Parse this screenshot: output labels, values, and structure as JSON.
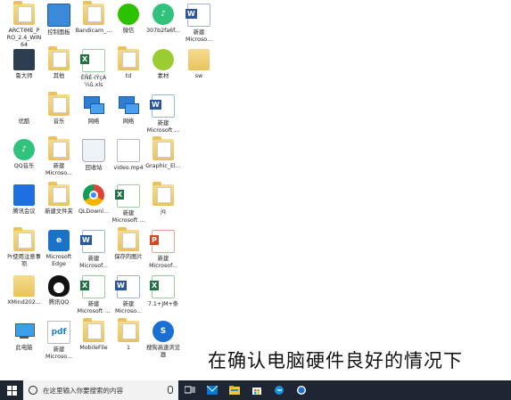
{
  "desktop": {
    "icons": [
      {
        "label": "ARCTIME_P\nRO_2.4_WIN\n64",
        "icon": "arctime-folder-icon",
        "glyph": "folder",
        "text": ""
      },
      {
        "label": "控制面板",
        "icon": "control-panel-icon",
        "glyph": "ctrl",
        "text": ""
      },
      {
        "label": "Bandicam_...",
        "icon": "bandicam-folder-icon",
        "glyph": "folder",
        "text": ""
      },
      {
        "label": "微信",
        "icon": "wechat-icon",
        "glyph": "wechat",
        "text": ""
      },
      {
        "label": "307b2fa6f...",
        "icon": "qq-music-file-icon",
        "glyph": "qqmusic",
        "text": "♪"
      },
      {
        "label": "新建\nMicroso...",
        "icon": "word-doc-icon",
        "glyph": "word",
        "text": "W"
      },
      {
        "label": "鲁大师",
        "icon": "ludashi-icon",
        "glyph": "dark",
        "text": ""
      },
      {
        "label": "其他",
        "icon": "folder-other-icon",
        "glyph": "folder",
        "text": ""
      },
      {
        "label": "ÊÑÈ-íÝçÁ\n¼û.xls",
        "icon": "excel-xls-icon",
        "glyph": "excel",
        "text": "X"
      },
      {
        "label": "td",
        "icon": "folder-td-icon",
        "glyph": "folder",
        "text": ""
      },
      {
        "label": "素材",
        "icon": "folder-sucai-icon",
        "glyph": "green",
        "text": ""
      },
      {
        "label": "sw",
        "icon": "folder-sw-icon",
        "glyph": "sw",
        "text": ""
      },
      {
        "label": "优酷",
        "icon": "youku-icon",
        "glyph": "youku",
        "text": ""
      },
      {
        "label": "音乐",
        "icon": "folder-music-icon",
        "glyph": "folder",
        "text": ""
      },
      {
        "label": "网络",
        "icon": "network-icon",
        "glyph": "net",
        "text": ""
      },
      {
        "label": "网络",
        "icon": "network-icon",
        "glyph": "net",
        "text": ""
      },
      {
        "label": "新建\nMicrosoft ...",
        "icon": "word-doc-icon",
        "glyph": "word",
        "text": "W"
      },
      {
        "label": "QQ音乐",
        "icon": "qq-music-icon",
        "glyph": "qqmusic",
        "text": "♪"
      },
      {
        "label": "新建\nMicroso...",
        "icon": "new-folder-icon",
        "glyph": "folder",
        "text": ""
      },
      {
        "label": "回收站",
        "icon": "recycle-bin-icon",
        "glyph": "bin",
        "text": ""
      },
      {
        "label": "video.mp4",
        "icon": "video-file-icon",
        "glyph": "video",
        "text": ""
      },
      {
        "label": "Graphic_El...",
        "icon": "graphic-folder-icon",
        "glyph": "folder",
        "text": ""
      },
      {
        "label": "腾讯会议",
        "icon": "tencent-meeting-icon",
        "glyph": "tencent",
        "text": ""
      },
      {
        "label": "新建文件夹",
        "icon": "new-folder-icon",
        "glyph": "folder",
        "text": ""
      },
      {
        "label": "QLDownl...",
        "icon": "chrome-folder-icon",
        "glyph": "chrome",
        "text": ""
      },
      {
        "label": "新建\nMicrosoft ...",
        "icon": "excel-doc-icon",
        "glyph": "excel",
        "text": "X"
      },
      {
        "label": "jq",
        "icon": "folder-jq-icon",
        "glyph": "folder",
        "text": ""
      },
      {
        "label": "Pr使用注意事\n项",
        "icon": "pr-folder-icon",
        "glyph": "folder",
        "text": ""
      },
      {
        "label": "Microsoft\nEdge",
        "icon": "edge-icon",
        "glyph": "edge",
        "text": "e"
      },
      {
        "label": "新建\nMicrosof...",
        "icon": "word-doc-icon",
        "glyph": "word",
        "text": "W"
      },
      {
        "label": "保存的图片",
        "icon": "saved-pictures-folder-icon",
        "glyph": "folder",
        "text": ""
      },
      {
        "label": "新建\nMicrosof...",
        "icon": "ppt-doc-icon",
        "glyph": "ppt",
        "text": "P"
      },
      {
        "label": "XMind202...",
        "icon": "xmind-folder-icon",
        "glyph": "xmind",
        "text": ""
      },
      {
        "label": "腾讯QQ",
        "icon": "qq-icon",
        "glyph": "penguin",
        "text": ""
      },
      {
        "label": "新建\nMicrosoft ...",
        "icon": "excel-doc-icon",
        "glyph": "excel",
        "text": "X"
      },
      {
        "label": "新建\nMicroso...",
        "icon": "word-doc-icon",
        "glyph": "word",
        "text": "W"
      },
      {
        "label": "7.1+JM+条",
        "icon": "excel-doc-icon",
        "glyph": "excel",
        "text": "X"
      },
      {
        "label": "此电脑",
        "icon": "this-pc-icon",
        "glyph": "pc",
        "text": ""
      },
      {
        "label": "新建\nMicroso...",
        "icon": "pdf-file-icon",
        "glyph": "pdf",
        "text": "pdf"
      },
      {
        "label": "MobileFile",
        "icon": "mobilefile-folder-icon",
        "glyph": "folder",
        "text": ""
      },
      {
        "label": "1",
        "icon": "folder-1-icon",
        "glyph": "folder",
        "text": ""
      },
      {
        "label": "搜狗高速浏览\n器",
        "icon": "sogou-browser-icon",
        "glyph": "sogou",
        "text": "S"
      }
    ]
  },
  "subtitle": "在确认电脑硬件良好的情况下",
  "taskbar": {
    "search_placeholder": "在这里输入你要搜索的内容",
    "items": [
      {
        "name": "task-view-icon"
      },
      {
        "name": "mail-icon"
      },
      {
        "name": "file-explorer-icon"
      },
      {
        "name": "store-icon"
      },
      {
        "name": "edge-icon"
      },
      {
        "name": "sogou-browser-icon"
      }
    ]
  }
}
